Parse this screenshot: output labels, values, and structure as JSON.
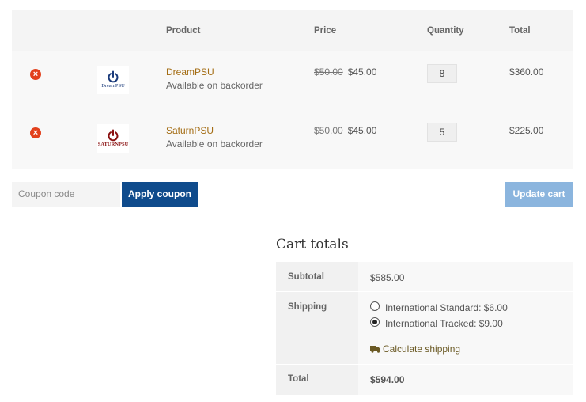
{
  "cart_table": {
    "headers": {
      "product": "Product",
      "price": "Price",
      "quantity": "Quantity",
      "total": "Total"
    },
    "items": [
      {
        "remove_icon": "×",
        "thumb_brand": "DreamPSU",
        "name": "DreamPSU",
        "stock": "Available on backorder",
        "old_price": "$50.00",
        "price": "$45.00",
        "quantity": "8",
        "total": "$360.00"
      },
      {
        "remove_icon": "×",
        "thumb_brand": "SATURNPSU",
        "name": "SaturnPSU",
        "stock": "Available on backorder",
        "old_price": "$50.00",
        "price": "$45.00",
        "quantity": "5",
        "total": "$225.00"
      }
    ]
  },
  "actions": {
    "coupon_placeholder": "Coupon code",
    "apply_coupon": "Apply coupon",
    "update_cart": "Update cart"
  },
  "cart_totals": {
    "title": "Cart totals",
    "subtotal_label": "Subtotal",
    "subtotal_value": "$585.00",
    "shipping_label": "Shipping",
    "shipping_options": [
      {
        "label": "International Standard: $6.00",
        "selected": false
      },
      {
        "label": "International Tracked: $9.00",
        "selected": true
      }
    ],
    "calculate_shipping": "Calculate shipping",
    "total_label": "Total",
    "total_value": "$594.00"
  },
  "colors": {
    "accent_link": "#a46d14",
    "primary_button": "#0f4b8c",
    "disabled_button": "#8bb5de",
    "remove_icon": "#e2401c"
  },
  "icons": {
    "remove": "remove-circle-icon",
    "truck": "truck-icon",
    "power": "power-icon"
  }
}
